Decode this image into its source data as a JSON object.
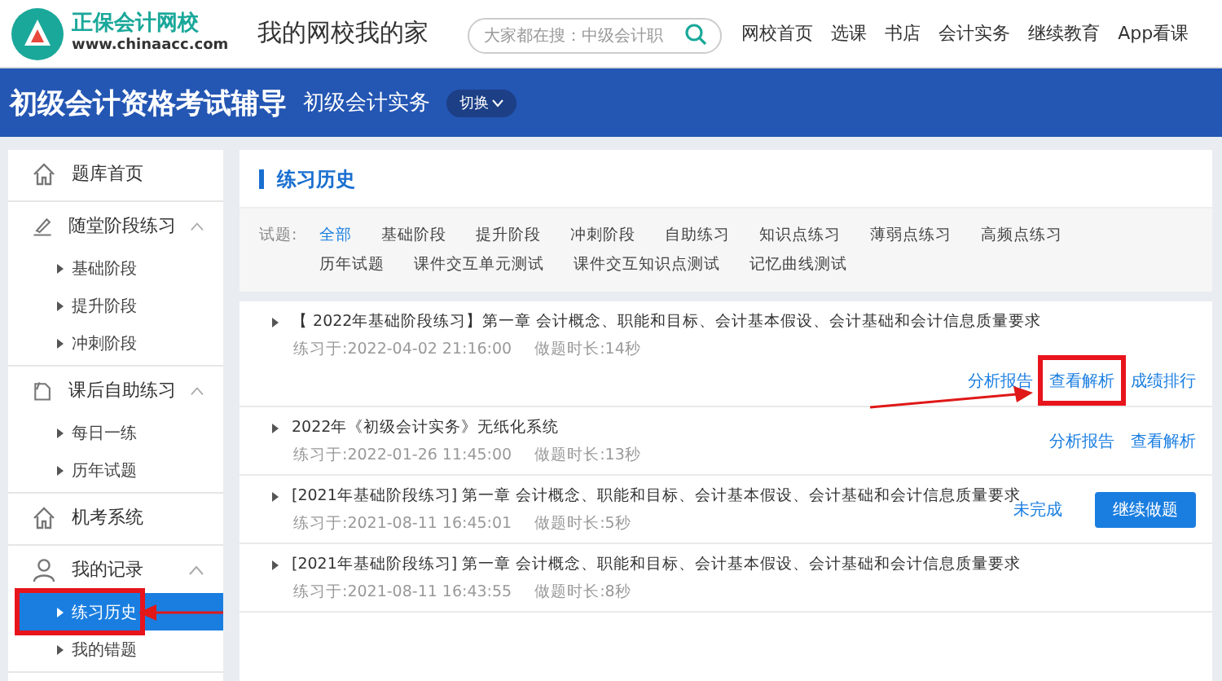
{
  "header": {
    "logo_title": "正保会计网校",
    "logo_url": "www.chinaacc.com",
    "slogan": "我的网校我的家",
    "search": {
      "placeholder": "大家都在搜：中级会计职"
    },
    "nav": [
      "网校首页",
      "选课",
      "书店",
      "会计实务",
      "继续教育",
      "App看课"
    ]
  },
  "banner": {
    "title": "初级会计资格考试辅导",
    "subject": "初级会计实务",
    "switch": "切换"
  },
  "sidebar": {
    "items": [
      {
        "label": "题库首页",
        "selected": false
      },
      {
        "label": "随堂阶段练习",
        "expanded": true,
        "children": [
          {
            "label": "基础阶段",
            "selected": false,
            "highlighted": false
          },
          {
            "label": "提升阶段",
            "selected": false,
            "highlighted": false
          },
          {
            "label": "冲刺阶段",
            "selected": false,
            "highlighted": false
          }
        ]
      },
      {
        "label": "课后自助练习",
        "expanded": true,
        "children": [
          {
            "label": "每日一练",
            "selected": false,
            "highlighted": false
          },
          {
            "label": "历年试题",
            "selected": false,
            "highlighted": false
          }
        ]
      },
      {
        "label": "机考系统",
        "selected": false
      },
      {
        "label": "我的记录",
        "expanded": true,
        "children": [
          {
            "label": "练习历史",
            "selected": true,
            "highlighted": true
          },
          {
            "label": "我的错题",
            "selected": false,
            "highlighted": false
          }
        ]
      }
    ]
  },
  "main": {
    "title": "练习历史",
    "filter_label": "试题:",
    "filters": [
      {
        "label": "全部",
        "selected": true
      },
      {
        "label": "基础阶段",
        "selected": false
      },
      {
        "label": "提升阶段",
        "selected": false
      },
      {
        "label": "冲刺阶段",
        "selected": false
      },
      {
        "label": "自助练习",
        "selected": false
      },
      {
        "label": "知识点练习",
        "selected": false
      },
      {
        "label": "薄弱点练习",
        "selected": false
      },
      {
        "label": "高频点练习",
        "selected": false
      },
      {
        "label": "历年试题",
        "selected": false
      },
      {
        "label": "课件交互单元测试",
        "selected": false
      },
      {
        "label": "课件交互知识点测试",
        "selected": false
      },
      {
        "label": "记忆曲线测试",
        "selected": false
      }
    ],
    "records": [
      {
        "kind": "stacked",
        "title": "【 2022年基础阶段练习】第一章 会计概念、职能和目标、会计基本假设、会计基础和会计信息质量要求",
        "practiced": "练习于:2022-04-02 21:16:00",
        "duration": "做题时长:14秒",
        "actions": [
          {
            "kind": "link",
            "label": "分析报告",
            "highlighted": false
          },
          {
            "kind": "link",
            "label": "查看解析",
            "highlighted": true
          },
          {
            "kind": "link",
            "label": "成绩排行",
            "highlighted": false
          }
        ]
      },
      {
        "kind": "inline",
        "title": "2022年《初级会计实务》无纸化系统",
        "practiced": "练习于:2022-01-26 11:45:00",
        "duration": "做题时长:13秒",
        "actions": [
          {
            "kind": "link",
            "label": "分析报告",
            "highlighted": false
          },
          {
            "kind": "link",
            "label": "查看解析",
            "highlighted": false
          }
        ]
      },
      {
        "kind": "inline",
        "title": "[2021年基础阶段练习] 第一章 会计概念、职能和目标、会计基本假设、会计基础和会计信息质量要求",
        "practiced": "练习于:2021-08-11 16:45:01",
        "duration": "做题时长:5秒",
        "actions": [
          {
            "kind": "status",
            "label": "未完成",
            "highlighted": false
          },
          {
            "kind": "button",
            "label": "继续做题",
            "highlighted": false
          }
        ]
      },
      {
        "kind": "inline",
        "title": "[2021年基础阶段练习] 第一章 会计概念、职能和目标、会计基本假设、会计基础和会计信息质量要求",
        "practiced": "练习于:2021-08-11 16:43:55",
        "duration": "做题时长:8秒"
      }
    ]
  }
}
